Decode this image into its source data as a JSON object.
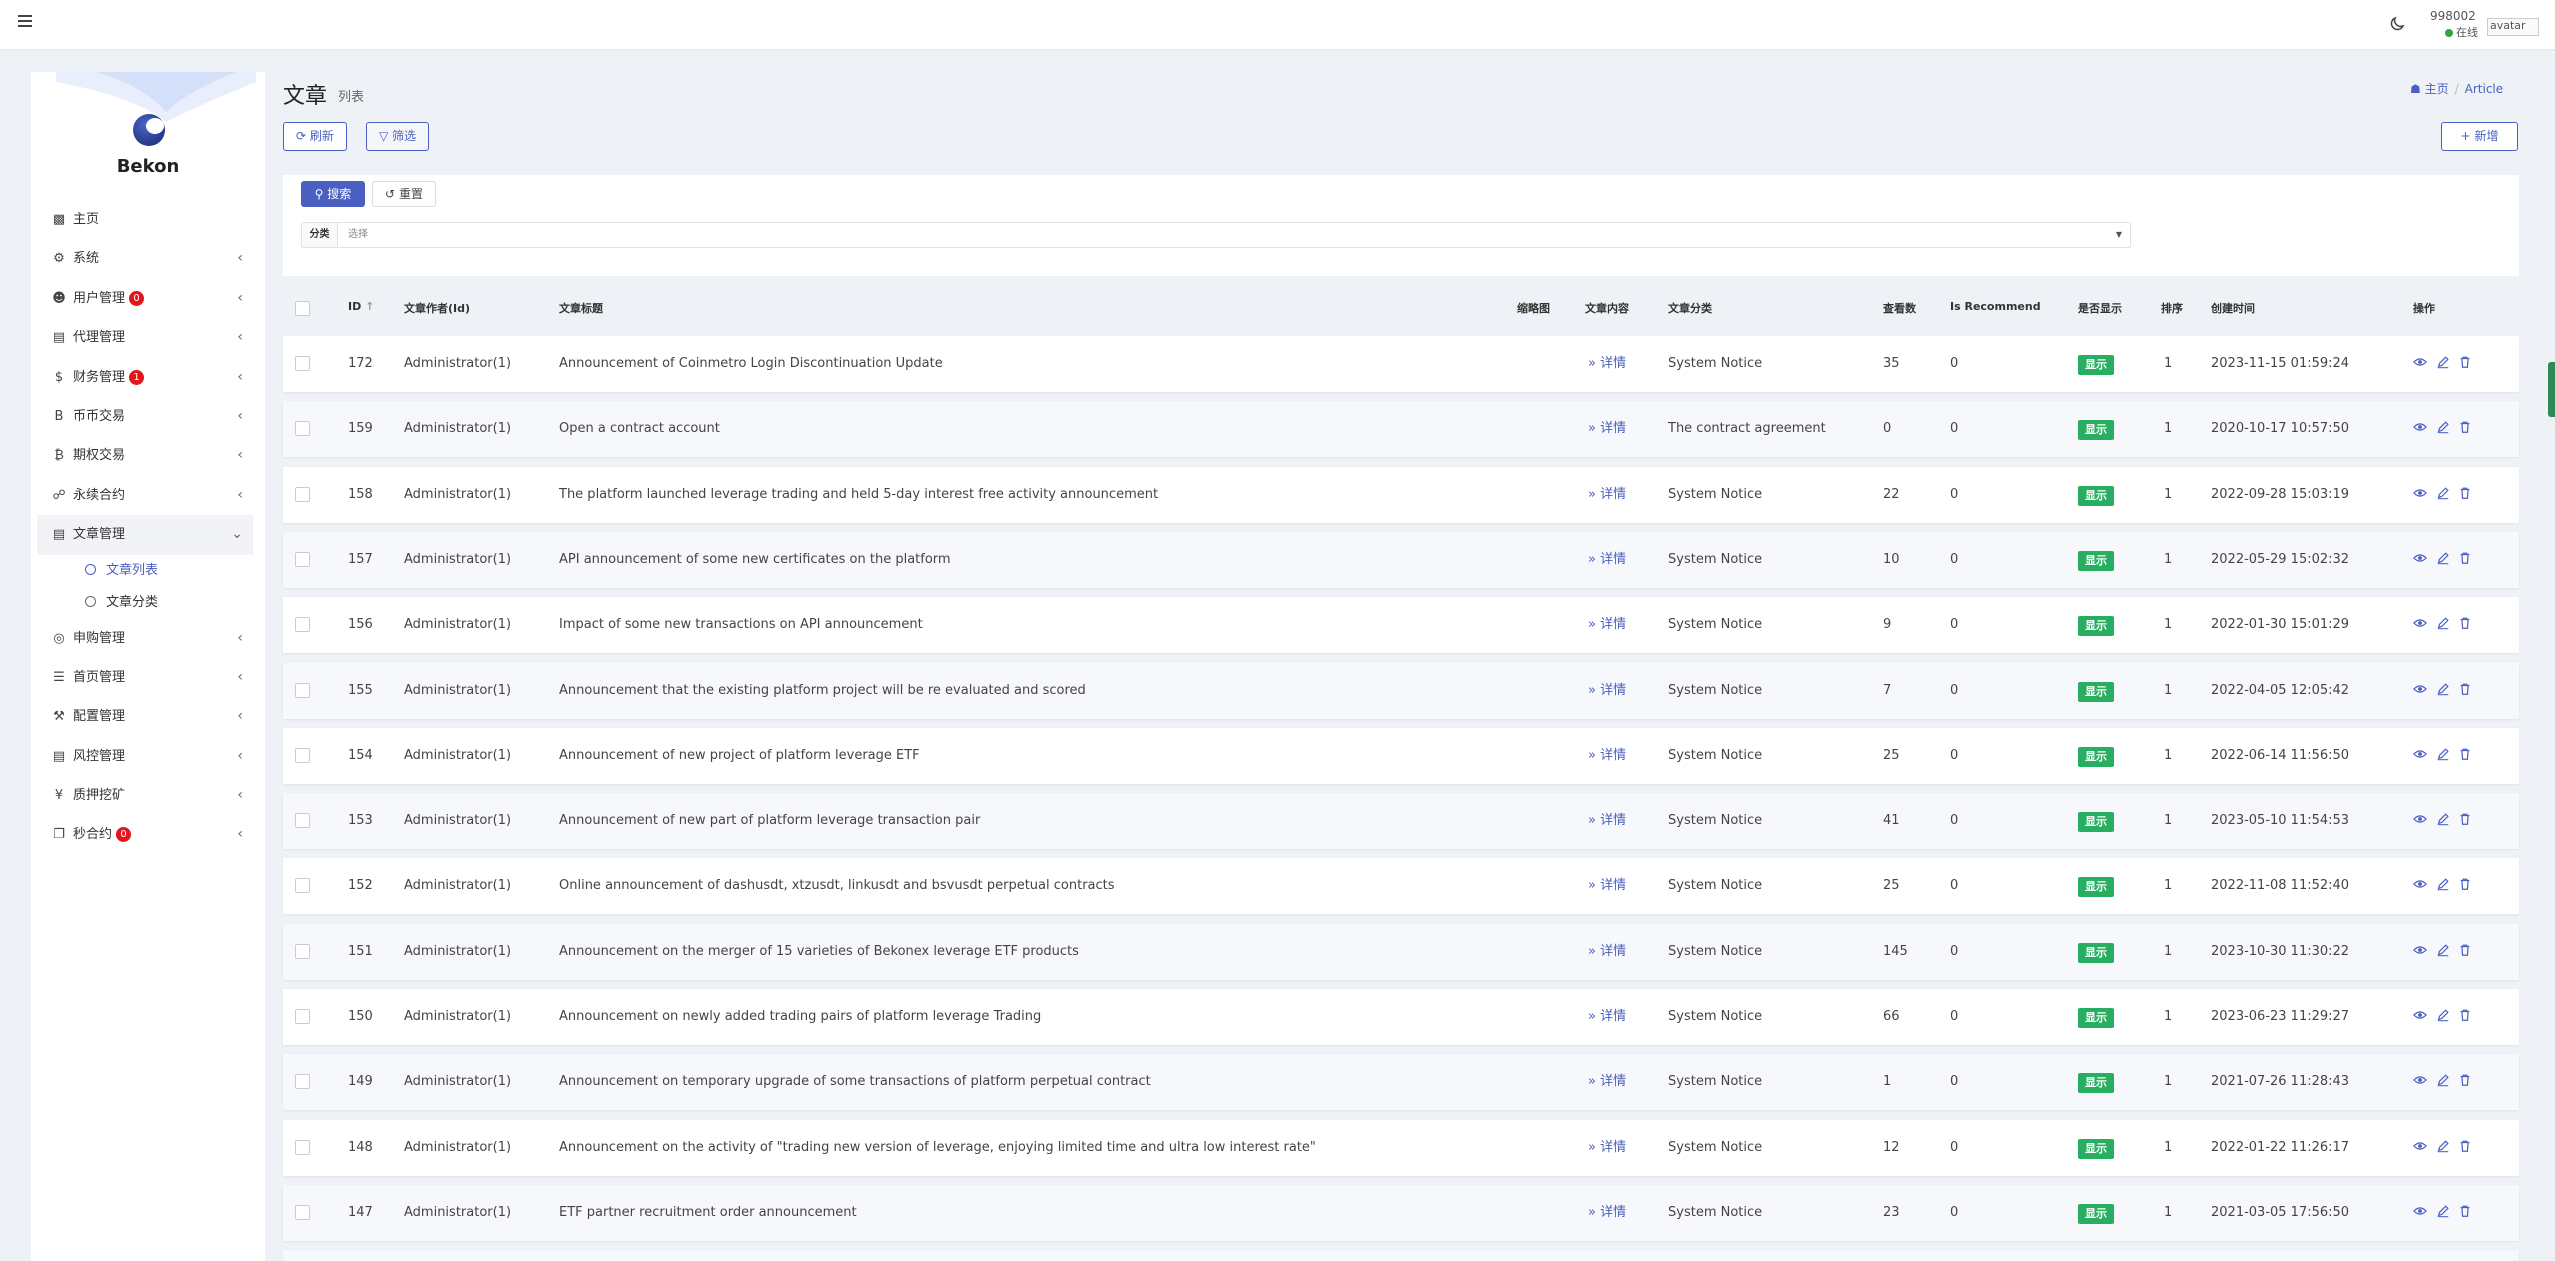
{
  "topbar": {
    "user_id": "998002",
    "status": "在线",
    "avatar_alt": "avatar"
  },
  "sidebar": {
    "brand": "Bekon",
    "menu": [
      {
        "label": "主页",
        "icon": "dashboard-icon",
        "has_children": false
      },
      {
        "label": "系统",
        "icon": "gear-icon",
        "has_children": true
      },
      {
        "label": "用户管理",
        "icon": "users-icon",
        "has_children": true,
        "badge": "0"
      },
      {
        "label": "代理管理",
        "icon": "id-card-icon",
        "has_children": true
      },
      {
        "label": "财务管理",
        "icon": "dollar-icon",
        "has_children": true,
        "badge": "1"
      },
      {
        "label": "币币交易",
        "icon": "bitcoin-icon",
        "has_children": true
      },
      {
        "label": "期权交易",
        "icon": "bitcoin-circle-icon",
        "has_children": true
      },
      {
        "label": "永续合约",
        "icon": "link-icon",
        "has_children": true
      },
      {
        "label": "文章管理",
        "icon": "newspaper-icon",
        "has_children": true,
        "expanded": true,
        "children": [
          {
            "label": "文章列表",
            "current": true
          },
          {
            "label": "文章分类",
            "current": false
          }
        ]
      },
      {
        "label": "申购管理",
        "icon": "globe-icon",
        "has_children": true
      },
      {
        "label": "首页管理",
        "icon": "list-icon",
        "has_children": true
      },
      {
        "label": "配置管理",
        "icon": "wrench-icon",
        "has_children": true
      },
      {
        "label": "风控管理",
        "icon": "newspaper-icon",
        "has_children": true
      },
      {
        "label": "质押挖矿",
        "icon": "yen-icon",
        "has_children": true
      },
      {
        "label": "秒合约",
        "icon": "copy-icon",
        "has_children": true,
        "badge": "0"
      }
    ]
  },
  "header": {
    "title": "文章",
    "subtitle": "列表",
    "breadcrumb_home": "主页",
    "breadcrumb_current": "Article"
  },
  "toolbar": {
    "refresh_label": "刷新",
    "filter_label": "筛选",
    "add_label": "新增"
  },
  "filter": {
    "search_label": "搜索",
    "reset_label": "重置",
    "category_label": "分类",
    "category_placeholder": "选择"
  },
  "table": {
    "columns": {
      "id": "ID",
      "author": "文章作者(Id)",
      "title": "文章标题",
      "thumb": "缩略图",
      "content": "文章内容",
      "category": "文章分类",
      "views": "查看数",
      "recommend": "Is Recommend",
      "show": "是否显示",
      "sort": "排序",
      "created": "创建时间",
      "actions": "操作"
    },
    "detail_label": "详情",
    "show_tag": "显示",
    "rows": [
      {
        "id": "172",
        "author": "Administrator(1)",
        "title": "Announcement of Coinmetro Login Discontinuation Update",
        "category": "System Notice",
        "views": "35",
        "recommend": "0",
        "sort": "1",
        "created": "2023-11-15 01:59:24"
      },
      {
        "id": "159",
        "author": "Administrator(1)",
        "title": "Open a contract account",
        "category": "The contract agreement",
        "views": "0",
        "recommend": "0",
        "sort": "1",
        "created": "2020-10-17 10:57:50"
      },
      {
        "id": "158",
        "author": "Administrator(1)",
        "title": "The platform launched leverage trading and held 5-day interest free activity announcement",
        "category": "System Notice",
        "views": "22",
        "recommend": "0",
        "sort": "1",
        "created": "2022-09-28 15:03:19"
      },
      {
        "id": "157",
        "author": "Administrator(1)",
        "title": "API announcement of some new certificates on the platform",
        "category": "System Notice",
        "views": "10",
        "recommend": "0",
        "sort": "1",
        "created": "2022-05-29 15:02:32"
      },
      {
        "id": "156",
        "author": "Administrator(1)",
        "title": "Impact of some new transactions on API announcement",
        "category": "System Notice",
        "views": "9",
        "recommend": "0",
        "sort": "1",
        "created": "2022-01-30 15:01:29"
      },
      {
        "id": "155",
        "author": "Administrator(1)",
        "title": "Announcement that the existing platform project will be re evaluated and scored",
        "category": "System Notice",
        "views": "7",
        "recommend": "0",
        "sort": "1",
        "created": "2022-04-05 12:05:42"
      },
      {
        "id": "154",
        "author": "Administrator(1)",
        "title": "Announcement of new project of platform leverage ETF",
        "category": "System Notice",
        "views": "25",
        "recommend": "0",
        "sort": "1",
        "created": "2022-06-14 11:56:50"
      },
      {
        "id": "153",
        "author": "Administrator(1)",
        "title": "Announcement of new part of platform leverage transaction pair",
        "category": "System Notice",
        "views": "41",
        "recommend": "0",
        "sort": "1",
        "created": "2023-05-10 11:54:53"
      },
      {
        "id": "152",
        "author": "Administrator(1)",
        "title": "Online announcement of dashusdt, xtzusdt, linkusdt and bsvusdt perpetual contracts",
        "category": "System Notice",
        "views": "25",
        "recommend": "0",
        "sort": "1",
        "created": "2022-11-08 11:52:40"
      },
      {
        "id": "151",
        "author": "Administrator(1)",
        "title": "Announcement on the merger of 15 varieties of Bekonex leverage ETF products",
        "category": "System Notice",
        "views": "145",
        "recommend": "0",
        "sort": "1",
        "created": "2023-10-30 11:30:22"
      },
      {
        "id": "150",
        "author": "Administrator(1)",
        "title": "Announcement on newly added trading pairs of platform leverage Trading",
        "category": "System Notice",
        "views": "66",
        "recommend": "0",
        "sort": "1",
        "created": "2023-06-23 11:29:27"
      },
      {
        "id": "149",
        "author": "Administrator(1)",
        "title": "Announcement on temporary upgrade of some transactions of platform perpetual contract",
        "category": "System Notice",
        "views": "1",
        "recommend": "0",
        "sort": "1",
        "created": "2021-07-26 11:28:43"
      },
      {
        "id": "148",
        "author": "Administrator(1)",
        "title": "Announcement on the activity of \"trading new version of leverage, enjoying limited time and ultra low interest rate\"",
        "category": "System Notice",
        "views": "12",
        "recommend": "0",
        "sort": "1",
        "created": "2022-01-22 11:26:17"
      },
      {
        "id": "147",
        "author": "Administrator(1)",
        "title": "ETF partner recruitment order announcement",
        "category": "System Notice",
        "views": "23",
        "recommend": "0",
        "sort": "1",
        "created": "2021-03-05 17:56:50"
      }
    ]
  }
}
